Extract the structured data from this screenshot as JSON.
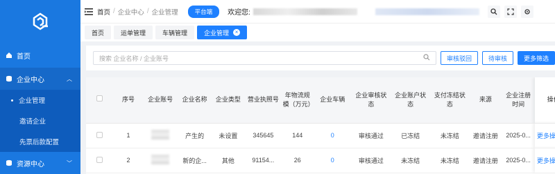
{
  "sidebar": {
    "home": "首页",
    "company_center": "企业中心",
    "sub_items": [
      "企业管理",
      "邀请企业",
      "先票后款配置"
    ],
    "resource_center": "资源中心"
  },
  "header": {
    "breadcrumb": [
      "首页",
      "企业中心",
      "企业管理"
    ],
    "platform_badge": "平台端",
    "welcome": "欢迎您:"
  },
  "tabs": [
    {
      "label": "首页",
      "active": false
    },
    {
      "label": "运单管理",
      "active": false
    },
    {
      "label": "车辆管理",
      "active": false
    },
    {
      "label": "企业管理",
      "active": true
    }
  ],
  "search": {
    "placeholder": "搜索 企业名称 / 企业账号",
    "buttons": [
      "审核驳回",
      "待审核",
      "更多筛选"
    ]
  },
  "table": {
    "headers": [
      "序号",
      "企业账号",
      "企业名称",
      "企业类型",
      "营业执照号",
      "年物流规模（万元）",
      "企业车辆",
      "企业审核状态",
      "企业账户状态",
      "支付冻结状态",
      "来源",
      "企业注册时间",
      "操作"
    ],
    "rows": [
      {
        "index": "1",
        "name": "产生的",
        "type": "未设置",
        "license": "345645",
        "scale": "144",
        "vehicles": "0",
        "audit": "审核通过",
        "account": "已冻结",
        "pay": "未冻结",
        "source": "邀请注册",
        "time": "2025-0...",
        "ops": "更多操作"
      },
      {
        "index": "2",
        "name": "新的企...",
        "type": "其他",
        "license": "91154...",
        "scale": "26",
        "vehicles": "0",
        "audit": "审核通过",
        "account": "未冻结",
        "pay": "未冻结",
        "source": "邀请注册",
        "time": "2025-0...",
        "ops": "更多操作"
      }
    ]
  },
  "colors": {
    "primary": "#1e80ff",
    "sidebar": "#1a78e0"
  }
}
